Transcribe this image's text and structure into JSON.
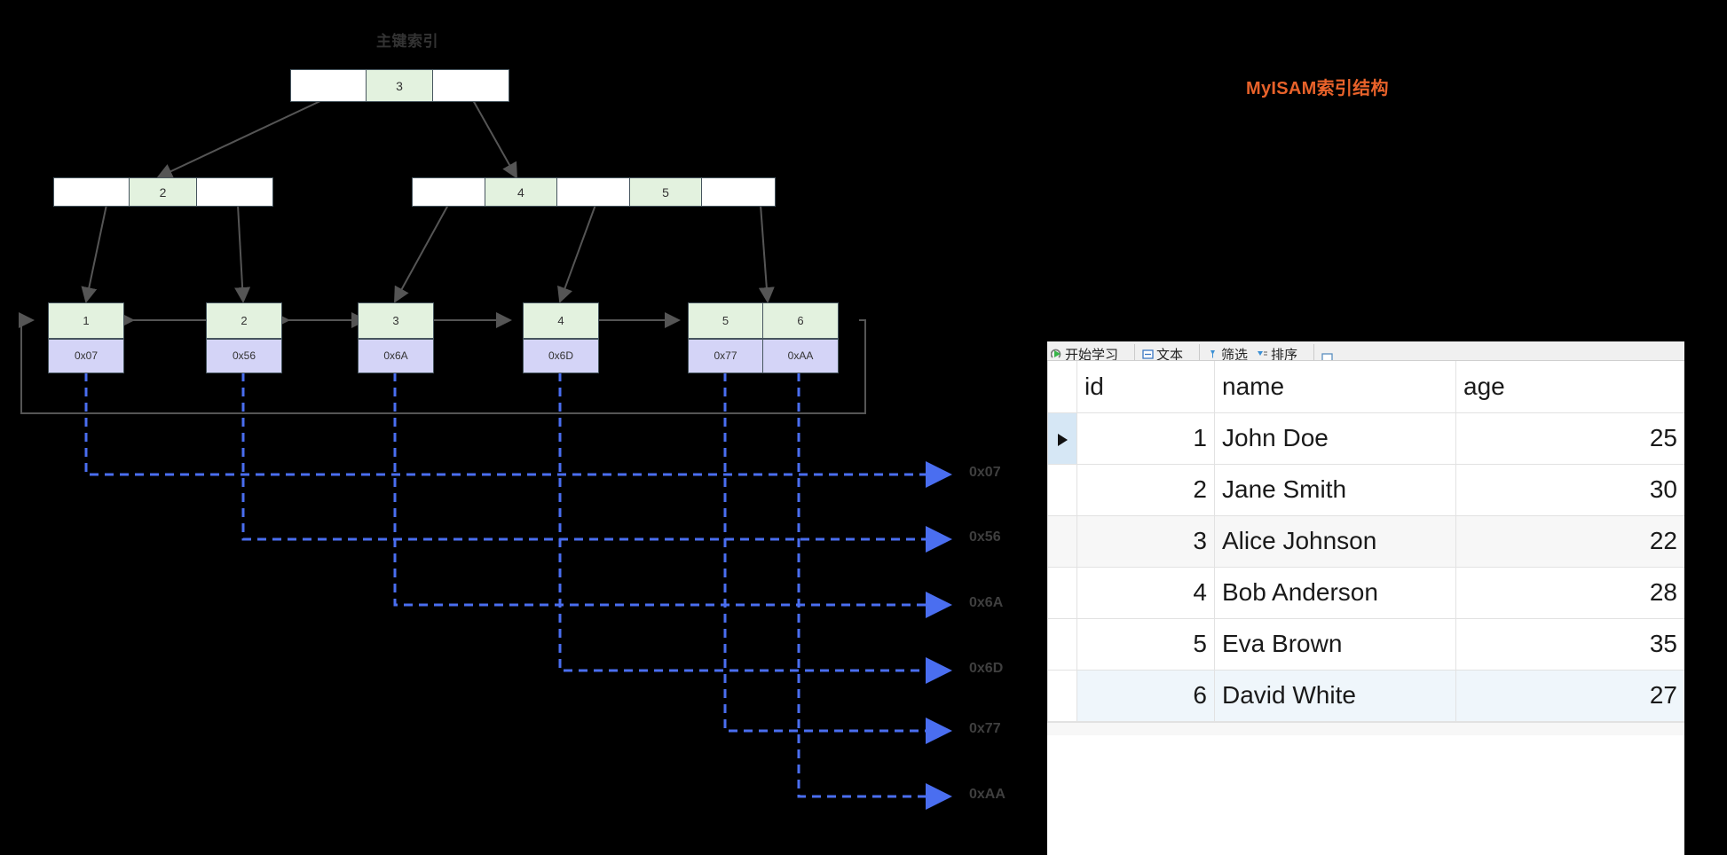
{
  "diagram": {
    "index_title": "主键索引",
    "myisam_title": "MyISAM索引结构",
    "root": {
      "cells": [
        {
          "text": "",
          "key": false
        },
        {
          "text": "3",
          "key": true
        },
        {
          "text": "",
          "key": false
        }
      ]
    },
    "internal": [
      {
        "cells": [
          {
            "text": "",
            "key": false
          },
          {
            "text": "2",
            "key": true
          },
          {
            "text": "",
            "key": false
          }
        ]
      },
      {
        "cells": [
          {
            "text": "",
            "key": false
          },
          {
            "text": "4",
            "key": true
          },
          {
            "text": "",
            "key": false
          },
          {
            "text": "5",
            "key": true
          },
          {
            "text": "",
            "key": false
          }
        ]
      }
    ],
    "leaves": [
      {
        "entries": [
          {
            "key": "1",
            "ptr": "0x07"
          }
        ]
      },
      {
        "entries": [
          {
            "key": "2",
            "ptr": "0x56"
          }
        ]
      },
      {
        "entries": [
          {
            "key": "3",
            "ptr": "0x6A"
          }
        ]
      },
      {
        "entries": [
          {
            "key": "4",
            "ptr": "0x6D"
          }
        ]
      },
      {
        "entries": [
          {
            "key": "5",
            "ptr": "0x77"
          },
          {
            "key": "6",
            "ptr": "0xAA"
          }
        ]
      }
    ],
    "addresses": [
      "0x07",
      "0x56",
      "0x6A",
      "0x6D",
      "0x77",
      "0xAA"
    ],
    "colors": {
      "key_fill": "#e3f2df",
      "pointer_fill": "#d4d4f7",
      "node_border": "#46555e",
      "dashed_line": "#4a6ef0",
      "tree_edge": "#555555",
      "title": "#333333",
      "accent": "#e8622a"
    }
  },
  "grid": {
    "toolbar": [
      {
        "label": "开始学习",
        "icon": "play-icon"
      },
      {
        "label": "文本",
        "icon": "text-icon"
      },
      {
        "label": "筛选",
        "icon": "filter-icon"
      },
      {
        "label": "排序",
        "icon": "sort-icon"
      }
    ],
    "columns": [
      "",
      "id",
      "name",
      "age"
    ],
    "rows": [
      {
        "id": "1",
        "name": "John Doe",
        "age": "25",
        "selected": true
      },
      {
        "id": "2",
        "name": "Jane Smith",
        "age": "30",
        "selected": false
      },
      {
        "id": "3",
        "name": "Alice Johnson",
        "age": "22",
        "selected": false
      },
      {
        "id": "4",
        "name": "Bob Anderson",
        "age": "28",
        "selected": false
      },
      {
        "id": "5",
        "name": "Eva Brown",
        "age": "35",
        "selected": false
      },
      {
        "id": "6",
        "name": "David White",
        "age": "27",
        "selected": false
      }
    ]
  }
}
